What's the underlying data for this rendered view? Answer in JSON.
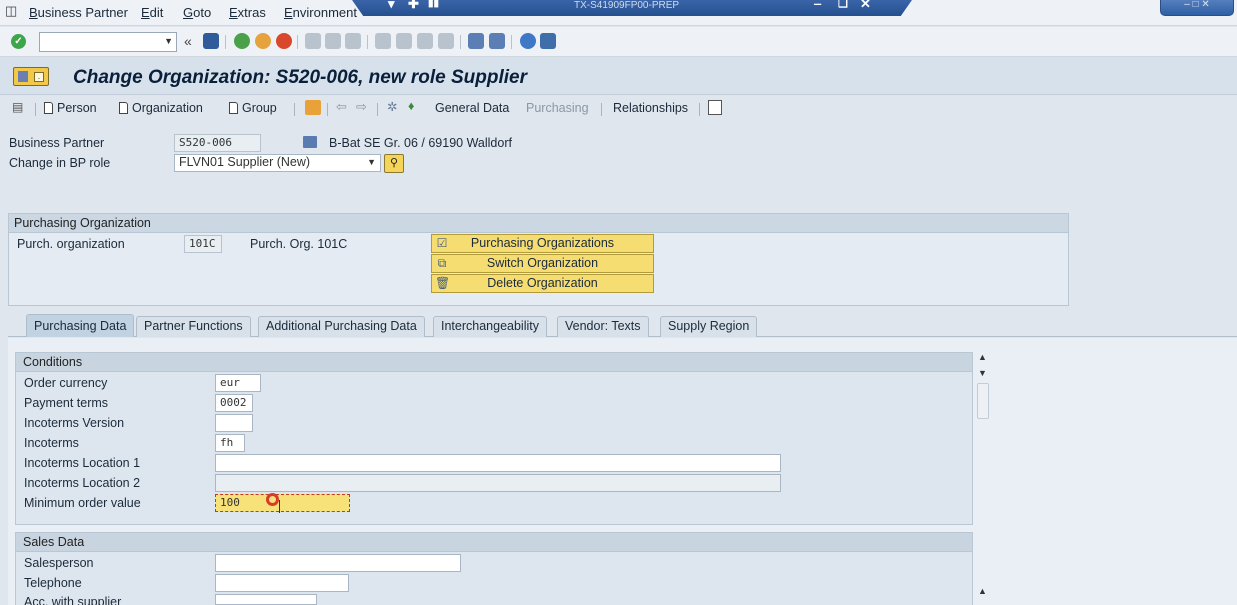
{
  "menu": {
    "items": [
      "Business Partner",
      "Edit",
      "Goto",
      "Extras",
      "Environment"
    ]
  },
  "window": {
    "system_title": "TX-S41909FP00-PREP"
  },
  "page": {
    "title": "Change Organization: S520-006, new role Supplier"
  },
  "app_toolbar": {
    "person": "Person",
    "organization": "Organization",
    "group": "Group",
    "general_data": "General Data",
    "purchasing": "Purchasing",
    "relationships": "Relationships"
  },
  "header": {
    "bp_label": "Business Partner",
    "bp_value": "S520-006",
    "bp_description": "B-Bat SE Gr. 06 / 69190 Walldorf",
    "role_label": "Change in BP role",
    "role_value": "FLVN01 Supplier (New)"
  },
  "purch_org": {
    "group_title": "Purchasing Organization",
    "label": "Purch. organization",
    "value": "101C",
    "description": "Purch. Org. 101C",
    "buttons": [
      "Purchasing Organizations",
      "Switch Organization",
      "Delete Organization"
    ]
  },
  "tabs": [
    "Purchasing Data",
    "Partner Functions",
    "Additional Purchasing Data",
    "Interchangeability",
    "Vendor: Texts",
    "Supply Region"
  ],
  "active_tab": 0,
  "conditions": {
    "title": "Conditions",
    "fields": [
      {
        "label": "Order currency",
        "value": "eur"
      },
      {
        "label": "Payment terms",
        "value": "0002"
      },
      {
        "label": "Incoterms Version",
        "value": ""
      },
      {
        "label": "Incoterms",
        "value": "fh"
      },
      {
        "label": "Incoterms Location 1",
        "value": ""
      },
      {
        "label": "Incoterms Location 2",
        "value": ""
      },
      {
        "label": "Minimum order value",
        "value": "100"
      }
    ]
  },
  "sales_data": {
    "title": "Sales Data",
    "fields": [
      {
        "label": "Salesperson",
        "value": ""
      },
      {
        "label": "Telephone",
        "value": ""
      },
      {
        "label": "Acc. with supplier",
        "value": ""
      }
    ]
  },
  "colors": {
    "accent_yellow": "#f6dd72",
    "title_blue": "#0a1f3a",
    "ok_green": "#3ea64a"
  }
}
